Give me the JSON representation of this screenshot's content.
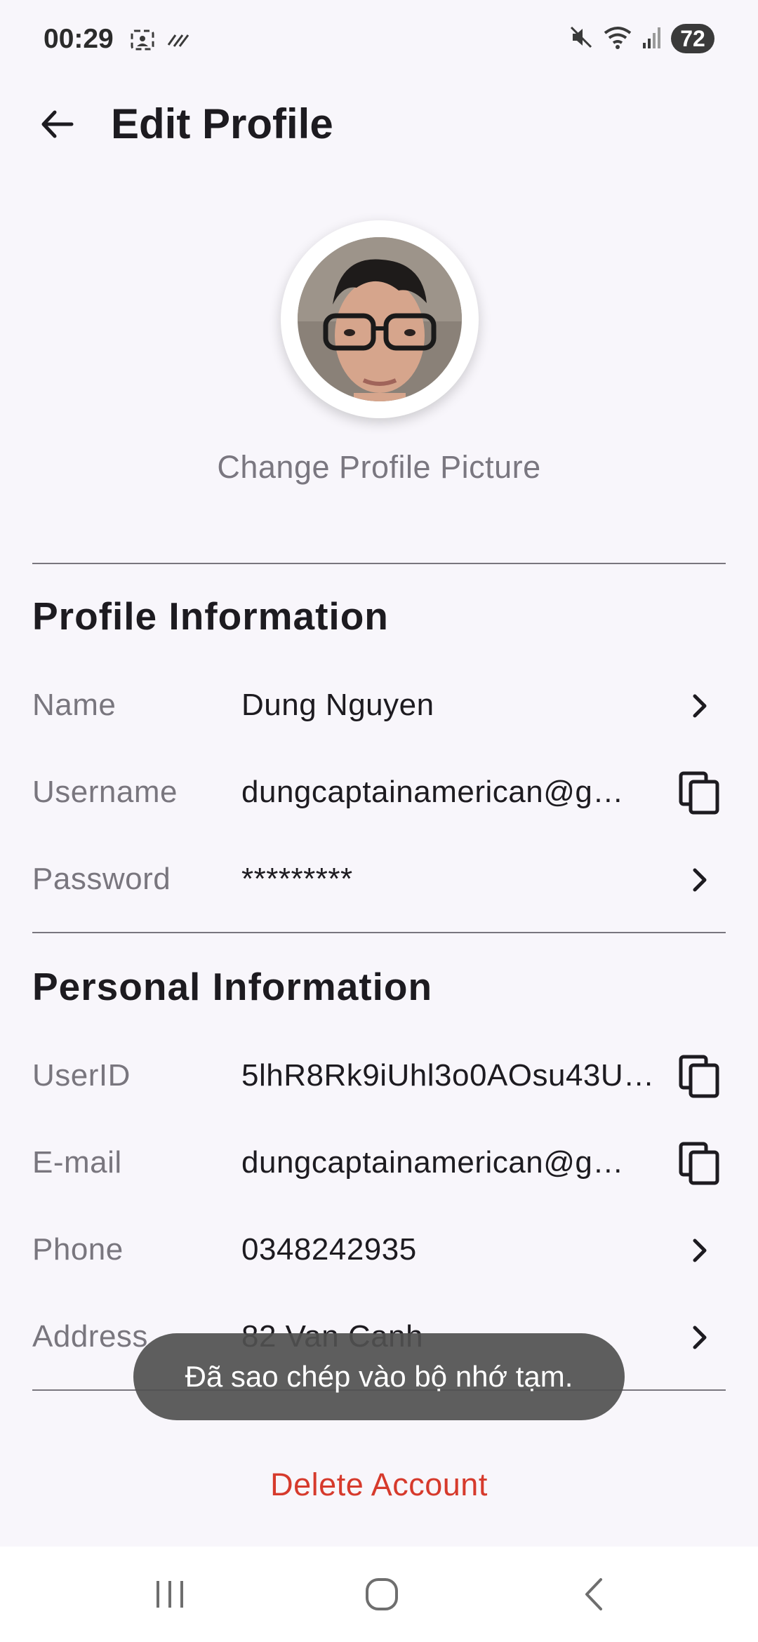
{
  "status": {
    "time": "00:29",
    "battery": "72"
  },
  "header": {
    "title": "Edit Profile"
  },
  "avatar": {
    "change_label": "Change Profile Picture"
  },
  "profile_section": {
    "title": "Profile Information",
    "rows": [
      {
        "label": "Name",
        "value": "Dung Nguyen",
        "action": "chevron-right-icon"
      },
      {
        "label": "Username",
        "value": "dungcaptainamerican@g…",
        "action": "copy-icon"
      },
      {
        "label": "Password",
        "value": "*********",
        "action": "chevron-right-icon"
      }
    ]
  },
  "personal_section": {
    "title": "Personal Information",
    "rows": [
      {
        "label": "UserID",
        "value": "5lhR8Rk9iUhl3o0AOsu43U…",
        "action": "copy-icon"
      },
      {
        "label": "E-mail",
        "value": "dungcaptainamerican@g…",
        "action": "copy-icon"
      },
      {
        "label": "Phone",
        "value": "0348242935",
        "action": "chevron-right-icon"
      },
      {
        "label": "Address",
        "value": "82 Van Canh",
        "action": "chevron-right-icon"
      }
    ]
  },
  "toast": {
    "message": "Đã sao chép vào bộ nhớ tạm."
  },
  "delete_label": "Delete Account",
  "colors": {
    "background": "#f8f6fb",
    "danger": "#d63a2c",
    "label": "#79767e"
  }
}
